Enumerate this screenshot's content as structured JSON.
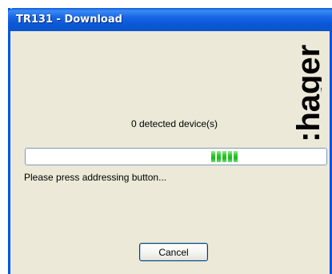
{
  "window": {
    "title": "TR131 - Download"
  },
  "brand": {
    "logo_text": ":hager",
    "color": "#000000"
  },
  "status": {
    "detected_devices_text": "0 detected device(s)"
  },
  "progress": {
    "style": "marquee",
    "block_count": 5,
    "position_fraction": 0.66,
    "color": "#1cb71c"
  },
  "instruction": {
    "text": "Please press addressing button..."
  },
  "buttons": {
    "cancel_label": "Cancel"
  },
  "colors": {
    "titlebar": "#0a58d6",
    "window_bg": "#ece9d8",
    "frame_border": "#0055e5"
  }
}
